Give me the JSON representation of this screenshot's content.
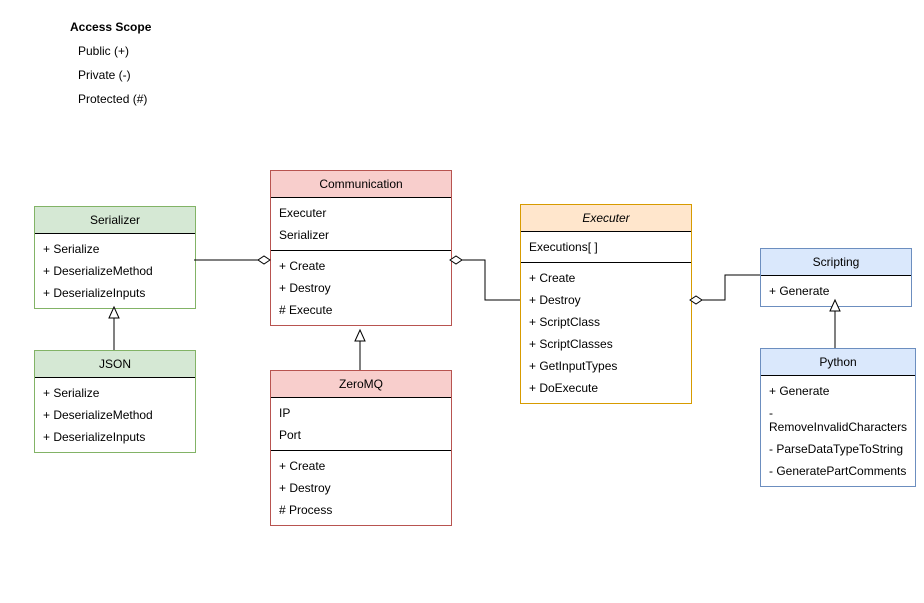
{
  "legend": {
    "title": "Access Scope",
    "items": [
      "Public (+)",
      "Private (-)",
      "Protected (#)"
    ]
  },
  "serializer": {
    "title": "Serializer",
    "methods": [
      "+ Serialize",
      "+ DeserializeMethod",
      "+ DeserializeInputs"
    ]
  },
  "json": {
    "title": "JSON",
    "methods": [
      "+ Serialize",
      "+ DeserializeMethod",
      "+ DeserializeInputs"
    ]
  },
  "communication": {
    "title": "Communication",
    "attrs": [
      "Executer",
      "Serializer"
    ],
    "methods": [
      "+ Create",
      "+ Destroy",
      "# Execute"
    ]
  },
  "zeromq": {
    "title": "ZeroMQ",
    "attrs": [
      "IP",
      "Port"
    ],
    "methods": [
      "+ Create",
      "+ Destroy",
      "# Process"
    ]
  },
  "executer": {
    "title": "Executer",
    "attrs": [
      "Executions[ ]"
    ],
    "methods": [
      "+ Create",
      "+ Destroy",
      "+ ScriptClass",
      "+ ScriptClasses",
      "+ GetInputTypes",
      "+ DoExecute"
    ]
  },
  "scripting": {
    "title": "Scripting",
    "methods": [
      "+ Generate"
    ]
  },
  "python": {
    "title": "Python",
    "methods": [
      "+ Generate",
      "- RemoveInvalidCharacters",
      "- ParseDataTypeToString",
      "- GeneratePartComments"
    ]
  }
}
